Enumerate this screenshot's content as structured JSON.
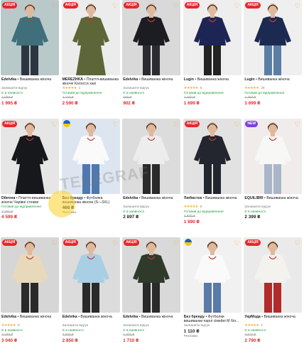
{
  "badge_sale": "АКЦІЯ",
  "badge_new": "NEW",
  "watermark": "TELEGRAF",
  "products": [
    {
      "sale": true,
      "new": false,
      "flag": false,
      "brand": "Edelvika",
      "sep": " • ",
      "name": "Вишиванка жіноча",
      "stars": "",
      "reviews": "",
      "note": "Залишити відгук",
      "status": "Є в наявності",
      "old": "2 099 ₴",
      "price": "1 995 ₴",
      "ads": "",
      "colors": {
        "bg": "#b9c8c9",
        "garment": "#3e6f7a",
        "skin": "#e0b99c",
        "bottom": "#2d3640"
      }
    },
    {
      "sale": true,
      "new": false,
      "flag": false,
      "brand": "MEREZHKA",
      "sep": " • ",
      "name": "Плаття-вишиванка жіноче Колосся хакі",
      "stars": "★★★★★",
      "reviews": "1",
      "note": "",
      "status": "Готовий до відправлення",
      "old": "3 150 ₴",
      "price": "2 590 ₴",
      "ads": "",
      "colors": {
        "bg": "#ececec",
        "garment": "#5c6638",
        "skin": "#e0b99c",
        "bottom": "#5c6638"
      }
    },
    {
      "sale": true,
      "new": false,
      "flag": false,
      "brand": "Edelvika",
      "sep": " • ",
      "name": "Вишиванка жіноча",
      "stars": "",
      "reviews": "",
      "note": "Залишити відгук",
      "status": "Є в наявності",
      "old": "949 ₴",
      "price": "902 ₴",
      "ads": "",
      "colors": {
        "bg": "#d9d9d9",
        "garment": "#1c1d22",
        "skin": "#e0b99c",
        "bottom": "#2b2b30"
      }
    },
    {
      "sale": true,
      "new": false,
      "flag": false,
      "brand": "Lugin",
      "sep": " • ",
      "name": "Вишиванка жіноча",
      "stars": "★★★★★",
      "reviews": "5",
      "note": "",
      "status": "Готовий до відправлення",
      "old": "2 360 ₴",
      "price": "1 699 ₴",
      "ads": "",
      "colors": {
        "bg": "#eeeeee",
        "garment": "#1d2555",
        "skin": "#e0b99c",
        "bottom": "#232323"
      }
    },
    {
      "sale": true,
      "new": false,
      "flag": false,
      "brand": "Lugin",
      "sep": " • ",
      "name": "Вишиванка жіноча",
      "stars": "★★★★★",
      "reviews": "26",
      "note": "",
      "status": "Готовий до відправлення",
      "old": "2 360 ₴",
      "price": "1 699 ₴",
      "ads": "",
      "colors": {
        "bg": "#efefef",
        "garment": "#1c2a52",
        "skin": "#e0b99c",
        "bottom": "#5b7ea5"
      }
    },
    {
      "sale": true,
      "new": false,
      "flag": false,
      "brand": "Dibrova",
      "sep": " • ",
      "name": "Плаття-вишиванка жіноче Чарівні стежки",
      "stars": "",
      "reviews": "",
      "note": "",
      "status": "Готовий до відправлення",
      "old": "7 200 ₴",
      "price": "4 599 ₴",
      "ads": "",
      "colors": {
        "bg": "#e6e6e6",
        "garment": "#17181c",
        "skin": "#e0b99c",
        "bottom": "#17181c"
      }
    },
    {
      "sale": false,
      "new": false,
      "flag": true,
      "brand": "Без бренду",
      "sep": " • ",
      "name": "Футболка вишиванка жіноча (S—3XL)",
      "stars": "",
      "reviews": "",
      "note": "",
      "status": "",
      "old": "",
      "price": "468 ₴",
      "ads": "Реклама",
      "colors": {
        "bg": "#dde6f0",
        "garment": "#fafafa",
        "skin": "#e0b99c",
        "bottom": "#4f78b0"
      }
    },
    {
      "sale": false,
      "new": false,
      "flag": false,
      "brand": "Edelvika",
      "sep": " • ",
      "name": "Вишиванка жіноча",
      "stars": "",
      "reviews": "",
      "note": "Залишити відгук",
      "status": "Є в наявності",
      "old": "",
      "price": "2 897 ₴",
      "ads": "",
      "colors": {
        "bg": "#dcdcdc",
        "garment": "#ededed",
        "skin": "#e0b99c",
        "bottom": "#2a2a2a"
      }
    },
    {
      "sale": true,
      "new": false,
      "flag": false,
      "brand": "Любисток",
      "sep": " • ",
      "name": "Вишиванка жіноча",
      "stars": "★★★★★",
      "reviews": "5",
      "note": "",
      "status": "Готовий до відправлення",
      "old": "3 800 ₴",
      "price": "1 990 ₴",
      "ads": "",
      "colors": {
        "bg": "#e2e2e2",
        "garment": "#23262e",
        "skin": "#e0b99c",
        "bottom": "#23262e"
      }
    },
    {
      "sale": false,
      "new": true,
      "flag": false,
      "brand": "EQUILIBRI",
      "sep": " • ",
      "name": "Вишиванка жіноча",
      "stars": "",
      "reviews": "",
      "note": "Залишити відгук",
      "status": "Є в наявності",
      "old": "",
      "price": "2 399 ₴",
      "ads": "",
      "colors": {
        "bg": "#f0ecec",
        "garment": "#f7f7f5",
        "skin": "#e0b99c",
        "bottom": "#a9b6c8"
      }
    },
    {
      "sale": true,
      "new": false,
      "flag": false,
      "brand": "Edelvika",
      "sep": " • ",
      "name": "Вишиванка жіноча",
      "stars": "★★★★★",
      "reviews": "8",
      "note": "",
      "status": "Є в наявності",
      "old": "3 199 ₴",
      "price": "3 040 ₴",
      "ads": "",
      "colors": {
        "bg": "#d6d6d6",
        "garment": "#e8d9bb",
        "skin": "#e0b99c",
        "bottom": "#2a2a2a"
      }
    },
    {
      "sale": true,
      "new": false,
      "flag": false,
      "brand": "Edelvika",
      "sep": " • ",
      "name": "Вишиванка жіноча",
      "stars": "",
      "reviews": "",
      "note": "Залишити відгук",
      "status": "Є в наявності",
      "old": "3 000 ₴",
      "price": "2 850 ₴",
      "ads": "",
      "colors": {
        "bg": "#dcdcdc",
        "garment": "#a9cfe4",
        "skin": "#e0b99c",
        "bottom": "#2a2a2a"
      }
    },
    {
      "sale": true,
      "new": false,
      "flag": false,
      "brand": "Edelvika",
      "sep": " • ",
      "name": "Вишиванка жіноча",
      "stars": "",
      "reviews": "",
      "note": "Залишити відгук",
      "status": "Є в наявності",
      "old": "1 800 ₴",
      "price": "1 710 ₴",
      "ads": "",
      "colors": {
        "bg": "#d9d9d9",
        "garment": "#2f3a2b",
        "skin": "#e0b99c",
        "bottom": "#2a2a2a"
      }
    },
    {
      "sale": false,
      "new": false,
      "flag": true,
      "brand": "Без бренду",
      "sep": " • ",
      "name": "Футболки вишиванки парні сімейні М біл...",
      "stars": "",
      "reviews": "",
      "note": "Залишити відгук",
      "status": "",
      "old": "",
      "price": "1 110 ₴",
      "ads": "Реклама",
      "colors": {
        "bg": "#f1f1f1",
        "garment": "#fafafa",
        "skin": "#e0b99c",
        "bottom": "#5a7aa8"
      }
    },
    {
      "sale": true,
      "new": false,
      "flag": false,
      "brand": "УкрМода",
      "sep": " • ",
      "name": "Вишиванка жіноча",
      "stars": "★★★★★",
      "reviews": "1",
      "note": "",
      "status": "Є в наявності",
      "old": "3 620 ₴",
      "price": "2 790 ₴",
      "ads": "",
      "colors": {
        "bg": "#eaeaea",
        "garment": "#f4f2ee",
        "skin": "#e0b99c",
        "bottom": "#b22a2a"
      }
    }
  ]
}
